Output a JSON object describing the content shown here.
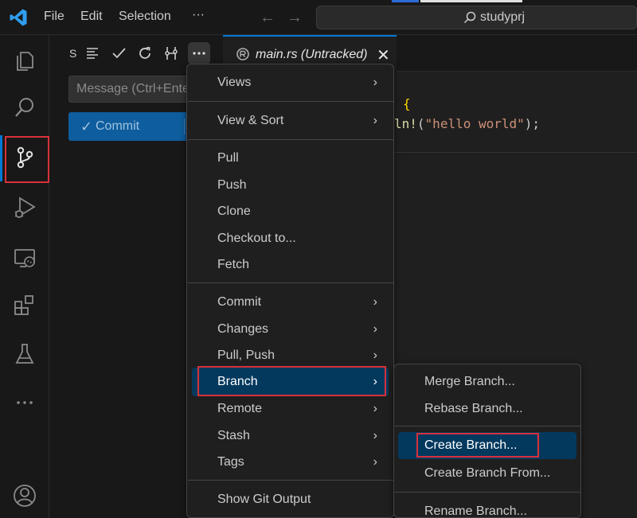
{
  "titlebar": {
    "menu": [
      "File",
      "Edit",
      "Selection",
      "···"
    ],
    "search_text": "studyprj"
  },
  "activity": [
    "explorer-icon",
    "search-icon",
    "source-control-icon",
    "run-debug-icon",
    "remote-explorer-icon",
    "extensions-icon",
    "testing-icon",
    "more-icon",
    "accounts-icon"
  ],
  "scm": {
    "title": "S",
    "message_placeholder": "Message (Ctrl+Enter",
    "commit_label": "Commit",
    "commit_check": "✓"
  },
  "editor": {
    "tab_name": "main.rs (Untracked)",
    "tab_close": "✕",
    "line1_brace": "{",
    "line2_fn": "ln!",
    "line2_open": "(",
    "line2_str": "\"hello world\"",
    "line2_close": ");"
  },
  "menu": {
    "items": [
      {
        "label": "Views",
        "arrow": "›"
      },
      {
        "label": "View & Sort",
        "arrow": "›"
      },
      {
        "label": "Pull"
      },
      {
        "label": "Push"
      },
      {
        "label": "Clone"
      },
      {
        "label": "Checkout to..."
      },
      {
        "label": "Fetch"
      },
      {
        "label": "Commit",
        "arrow": "›"
      },
      {
        "label": "Changes",
        "arrow": "›"
      },
      {
        "label": "Pull, Push",
        "arrow": "›"
      },
      {
        "label": "Branch",
        "arrow": "›"
      },
      {
        "label": "Remote",
        "arrow": "›"
      },
      {
        "label": "Stash",
        "arrow": "›"
      },
      {
        "label": "Tags",
        "arrow": "›"
      },
      {
        "label": "Show Git Output"
      }
    ]
  },
  "submenu": {
    "items": [
      {
        "label": "Merge Branch..."
      },
      {
        "label": "Rebase Branch..."
      },
      {
        "label": "Create Branch..."
      },
      {
        "label": "Create Branch From..."
      },
      {
        "label": "Rename Branch..."
      }
    ]
  },
  "colors": {
    "accent": "#0078d4",
    "highlight_box": "#d8313b",
    "selection": "#04395e"
  }
}
